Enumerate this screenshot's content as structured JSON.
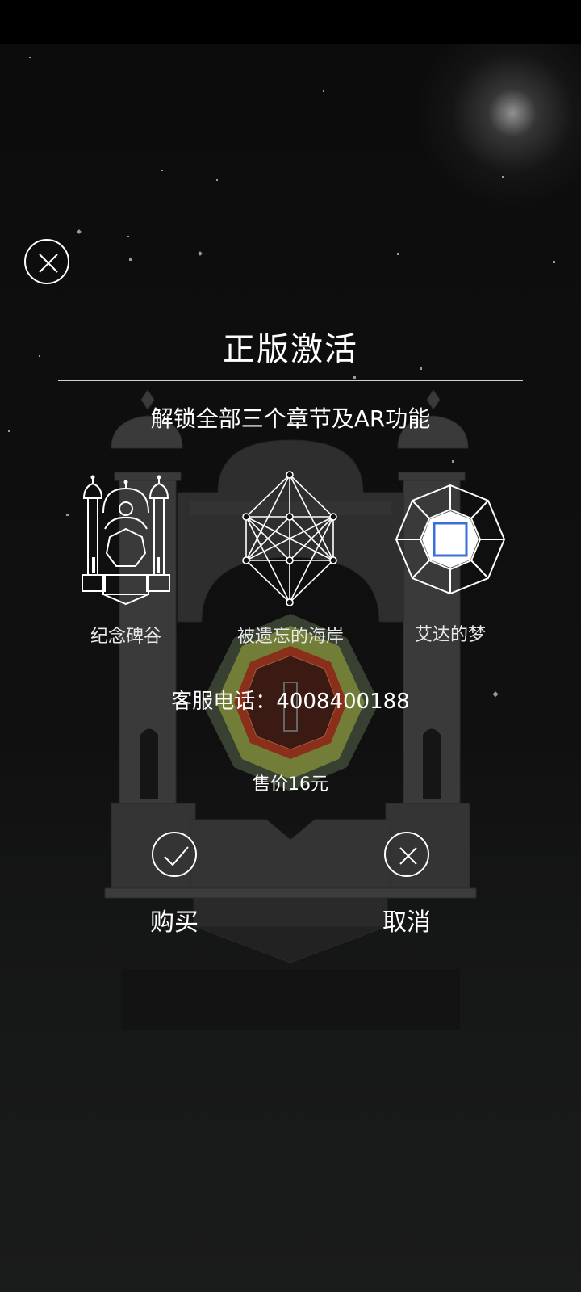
{
  "dialog": {
    "title": "正版激活",
    "subtitle": "解锁全部三个章节及AR功能",
    "chapters": [
      {
        "label": "纪念碑谷",
        "icon": "monument-shrine-icon"
      },
      {
        "label": "被遗忘的海岸",
        "icon": "geometric-crystal-icon"
      },
      {
        "label": "艾达的梦",
        "icon": "octagon-square-icon"
      }
    ],
    "service_phone": "客服电话：4008400188",
    "price": "售价16元",
    "buy_label": "购买",
    "cancel_label": "取消"
  },
  "icons": {
    "close": "close-icon",
    "buy": "check-icon",
    "cancel": "close-icon"
  },
  "colors": {
    "background": "#0b0b0b",
    "text": "#ffffff",
    "accent_blue": "#3a6fd8",
    "rule": "#cfcfcf"
  }
}
